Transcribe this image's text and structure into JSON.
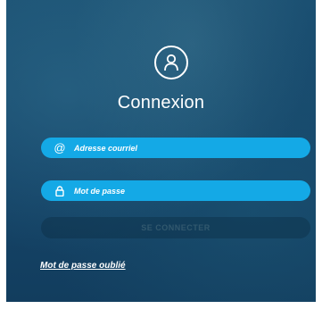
{
  "login": {
    "title": "Connexion",
    "email": {
      "icon": "at-sign-icon",
      "placeholder": "Adresse courriel"
    },
    "password": {
      "icon": "lock-icon",
      "placeholder": "Mot de passe"
    },
    "submit_label": "SE CONNECTER",
    "forgot_link": "Mot de passe oublié"
  },
  "colors": {
    "panel_bg": "#154566",
    "field_bg": "#14a9e6",
    "text": "#ffffff"
  }
}
